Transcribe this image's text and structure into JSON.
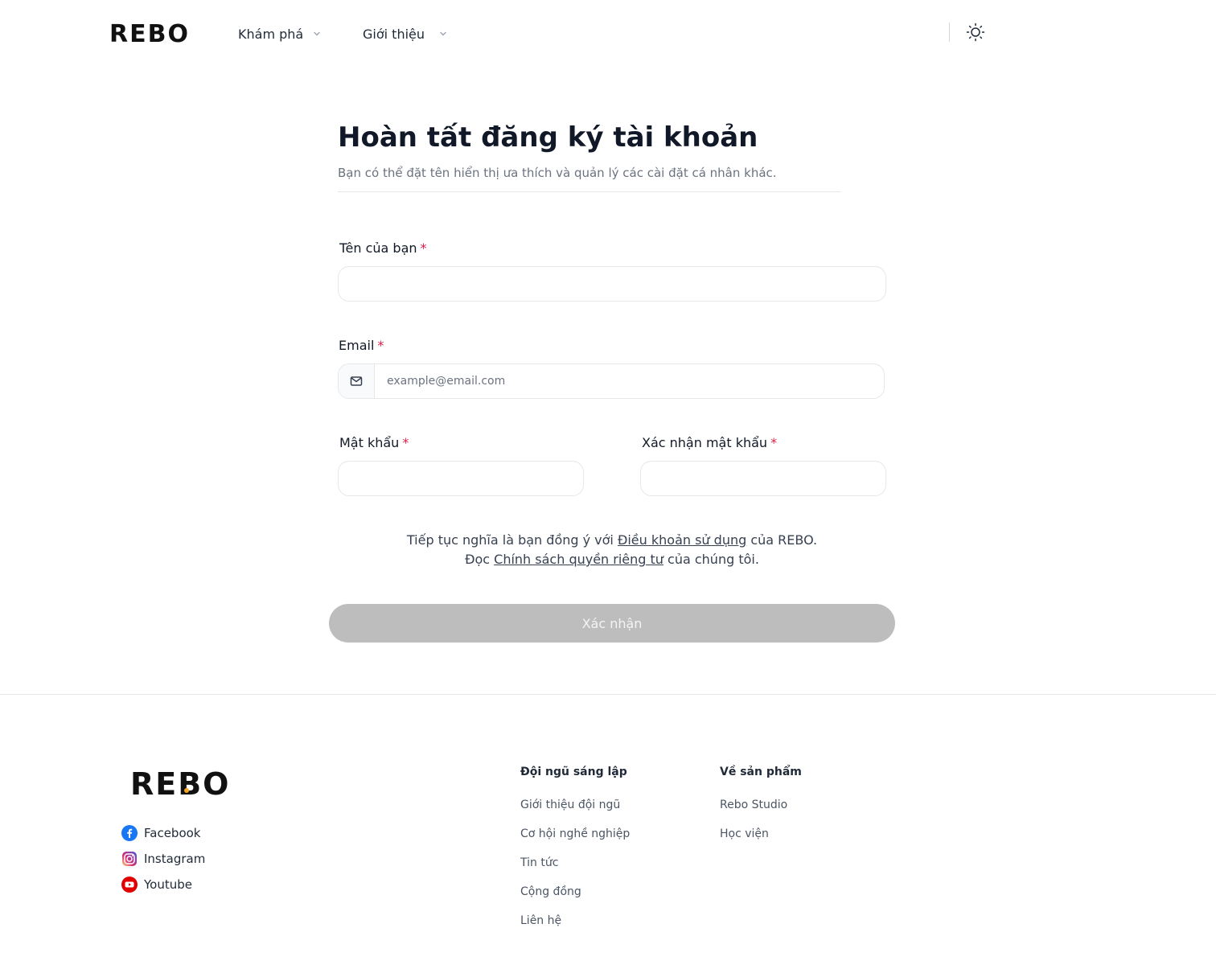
{
  "header": {
    "logo": "REBO",
    "nav": [
      {
        "label": "Khám phá"
      },
      {
        "label": "Giới thiệu"
      }
    ]
  },
  "page": {
    "title": "Hoàn tất đăng ký tài khoản",
    "subtitle": "Bạn có thể đặt tên hiển thị ưa thích và quản lý các cài đặt cá nhân khác."
  },
  "form": {
    "name": {
      "label": "Tên của bạn",
      "value": ""
    },
    "email": {
      "label": "Email",
      "placeholder": "example@email.com",
      "value": ""
    },
    "password": {
      "label": "Mật khẩu",
      "value": ""
    },
    "confirm_password": {
      "label": "Xác nhận mật khẩu",
      "value": ""
    },
    "required_mark": "*",
    "terms": {
      "line1_prefix": "Tiếp tục nghĩa là bạn đồng ý với ",
      "terms_link": "Điều khoản sử dụng",
      "line1_suffix": " của REBO.",
      "line2_prefix": "Đọc ",
      "privacy_link": "Chính sách quyền riêng tư",
      "line2_suffix": " của chúng tôi."
    },
    "submit_label": "Xác nhận",
    "submit_disabled_color": "#bdbdbd"
  },
  "footer": {
    "logo": "REBO",
    "social": [
      {
        "label": "Facebook",
        "icon": "facebook-icon",
        "color": "#1877f2"
      },
      {
        "label": "Instagram",
        "icon": "instagram-icon",
        "color": "#e1306c"
      },
      {
        "label": "Youtube",
        "icon": "youtube-icon",
        "color": "#e00000"
      }
    ],
    "columns": [
      {
        "title": "Đội ngũ sáng lập",
        "links": [
          "Giới thiệu đội ngũ",
          "Cơ hội nghề nghiệp",
          "Tin tức",
          "Cộng đồng",
          "Liên hệ"
        ]
      },
      {
        "title": "Về sản phẩm",
        "links": [
          "Rebo Studio",
          "Học viện"
        ]
      }
    ]
  }
}
